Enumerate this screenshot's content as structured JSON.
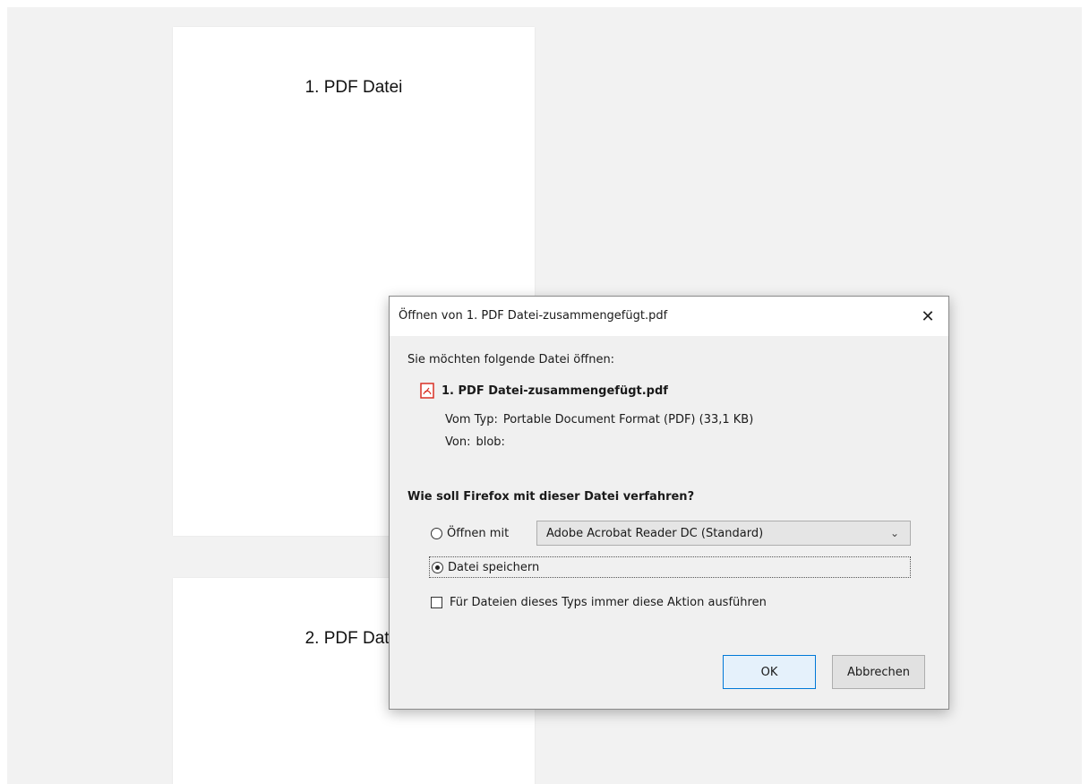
{
  "viewer": {
    "pages": [
      {
        "text": "1. PDF Datei"
      },
      {
        "text": "2. PDF Datei"
      }
    ]
  },
  "dialog": {
    "title": "Öffnen von 1. PDF Datei-zusammengefügt.pdf",
    "close_label": "✕",
    "intro": "Sie möchten folgende Datei öffnen:",
    "file_name": "1. PDF Datei-zusammengefügt.pdf",
    "file_icon": "pdf-file-icon",
    "type_label": "Vom Typ:",
    "type_value": "Portable Document Format (PDF) (33,1 KB)",
    "from_label": "Von:",
    "from_value": "blob:",
    "question": "Wie soll Firefox mit dieser Datei verfahren?",
    "open_with_label": "Öffnen mit",
    "open_with_value": "Adobe Acrobat Reader DC (Standard)",
    "save_label": "Datei speichern",
    "always_label": "Für Dateien dieses Typs immer diese Aktion ausführen",
    "ok_label": "OK",
    "cancel_label": "Abbrechen"
  },
  "colors": {
    "dialog_bg": "#f0f0f0",
    "ok_border": "#0078d7",
    "pdf_icon": "#d93025"
  }
}
